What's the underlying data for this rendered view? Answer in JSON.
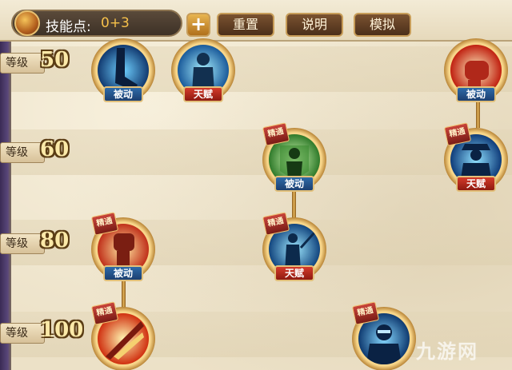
{
  "header": {
    "skill_points_label": "技能点:",
    "skill_points_value": "0+3",
    "add_button": "+",
    "reset_button": "重置",
    "help_button": "说明",
    "simulate_button": "模拟"
  },
  "levels": [
    {
      "label": "等级",
      "value": "50"
    },
    {
      "label": "等级",
      "value": "60"
    },
    {
      "label": "等级",
      "value": "80"
    },
    {
      "label": "等级",
      "value": "100"
    }
  ],
  "skills": [
    {
      "id": "s1",
      "icon": "blue-leg-icon",
      "badge": "被动",
      "mastered": false
    },
    {
      "id": "s2",
      "icon": "blue-figure-icon",
      "badge": "天赋",
      "mastered": false
    },
    {
      "id": "s3",
      "icon": "red-fist-icon",
      "badge": "被动",
      "mastered": false
    },
    {
      "id": "s4",
      "icon": "green-figure-icon",
      "badge": "被动",
      "mastered": true
    },
    {
      "id": "s5",
      "icon": "blue-hat-figure-icon",
      "badge": "天赋",
      "mastered": true
    },
    {
      "id": "s6",
      "icon": "red-fist-up-icon",
      "badge": "被动",
      "mastered": true
    },
    {
      "id": "s7",
      "icon": "blue-swordsman-icon",
      "badge": "天赋",
      "mastered": true
    },
    {
      "id": "s8",
      "icon": "red-blade-icon",
      "badge": "",
      "mastered": true
    },
    {
      "id": "s9",
      "icon": "blue-glasses-figure-icon",
      "badge": "",
      "mastered": true
    }
  ],
  "master_label": "精通",
  "watermark": "九游网"
}
